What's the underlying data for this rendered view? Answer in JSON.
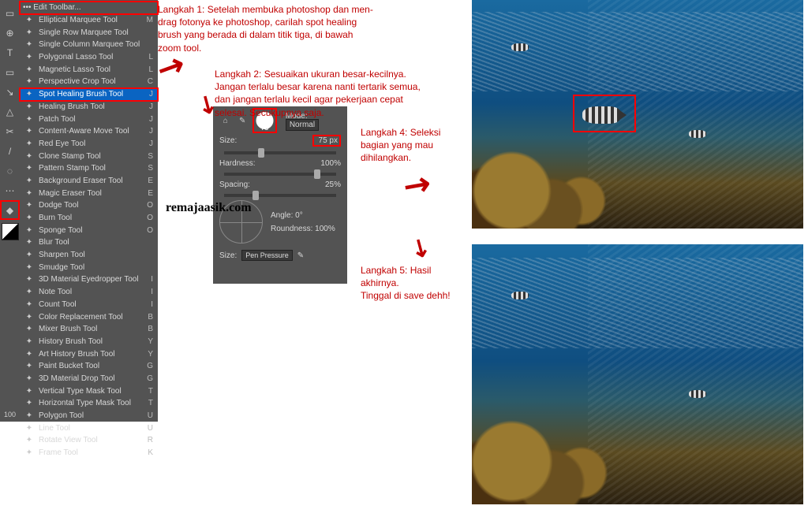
{
  "toolbar": {
    "header": "••• Edit Toolbar...",
    "zoom": "100",
    "items": [
      {
        "label": "Elliptical Marquee Tool",
        "key": "M"
      },
      {
        "label": "Single Row Marquee Tool",
        "key": ""
      },
      {
        "label": "Single Column Marquee Tool",
        "key": ""
      },
      {
        "label": "Polygonal Lasso Tool",
        "key": "L"
      },
      {
        "label": "Magnetic Lasso Tool",
        "key": "L"
      },
      {
        "label": "Perspective Crop Tool",
        "key": "C"
      },
      {
        "label": "Spot Healing Brush Tool",
        "key": "J",
        "selected": true
      },
      {
        "label": "Healing Brush Tool",
        "key": "J"
      },
      {
        "label": "Patch Tool",
        "key": "J"
      },
      {
        "label": "Content-Aware Move Tool",
        "key": "J"
      },
      {
        "label": "Red Eye Tool",
        "key": "J"
      },
      {
        "label": "Clone Stamp Tool",
        "key": "S"
      },
      {
        "label": "Pattern Stamp Tool",
        "key": "S"
      },
      {
        "label": "Background Eraser Tool",
        "key": "E"
      },
      {
        "label": "Magic Eraser Tool",
        "key": "E"
      },
      {
        "label": "Dodge Tool",
        "key": "O"
      },
      {
        "label": "Burn Tool",
        "key": "O"
      },
      {
        "label": "Sponge Tool",
        "key": "O"
      },
      {
        "label": "Blur Tool",
        "key": ""
      },
      {
        "label": "Sharpen Tool",
        "key": ""
      },
      {
        "label": "Smudge Tool",
        "key": ""
      },
      {
        "label": "3D Material Eyedropper Tool",
        "key": "I"
      },
      {
        "label": "Note Tool",
        "key": "I"
      },
      {
        "label": "Count Tool",
        "key": "I"
      },
      {
        "label": "Color Replacement Tool",
        "key": "B"
      },
      {
        "label": "Mixer Brush Tool",
        "key": "B"
      },
      {
        "label": "History Brush Tool",
        "key": "Y"
      },
      {
        "label": "Art History Brush Tool",
        "key": "Y"
      },
      {
        "label": "Paint Bucket Tool",
        "key": "G"
      },
      {
        "label": "3D Material Drop Tool",
        "key": "G"
      },
      {
        "label": "Vertical Type Mask Tool",
        "key": "T"
      },
      {
        "label": "Horizontal Type Mask Tool",
        "key": "T"
      },
      {
        "label": "Polygon Tool",
        "key": "U"
      },
      {
        "label": "Line Tool",
        "key": "U"
      },
      {
        "label": "Rotate View Tool",
        "key": "R"
      },
      {
        "label": "Frame Tool",
        "key": "K"
      }
    ]
  },
  "tool_icons": [
    "▭",
    "⊕",
    "T",
    "▢",
    "↘",
    "△",
    "✂",
    "/",
    "◌",
    "⋯",
    "◆",
    "■"
  ],
  "brush_panel": {
    "thumb_val": "75",
    "mode_label": "Mode:",
    "mode_value": "Normal",
    "size_label": "Size:",
    "size_value": "75 px",
    "hardness_label": "Hardness:",
    "hardness_value": "100%",
    "spacing_label": "Spacing:",
    "spacing_value": "25%",
    "angle_label": "Angle:",
    "angle_value": "0°",
    "roundness_label": "Roundness:",
    "roundness_value": "100%",
    "size_src_label": "Size:",
    "size_src_value": "Pen Pressure"
  },
  "steps": {
    "s1": "Langkah 1: Setelah membuka photoshop dan men-drag fotonya ke photoshop, carilah spot healing brush yang berada di dalam titik tiga, di bawah zoom tool.",
    "s2": "Langkah 2: Sesuaikan ukuran besar-kecilnya. Jangan terlalu besar karena nanti tertarik semua, dan jangan terlalu kecil agar pekerjaan cepat selesai. Secukupnya saja.",
    "s4": "Langkah 4: Seleksi bagian yang mau dihilangkan.",
    "s5": "Langkah 5: Hasil akhirnya.\nTinggal di save dehh!"
  },
  "watermark": "remajaasik.com"
}
